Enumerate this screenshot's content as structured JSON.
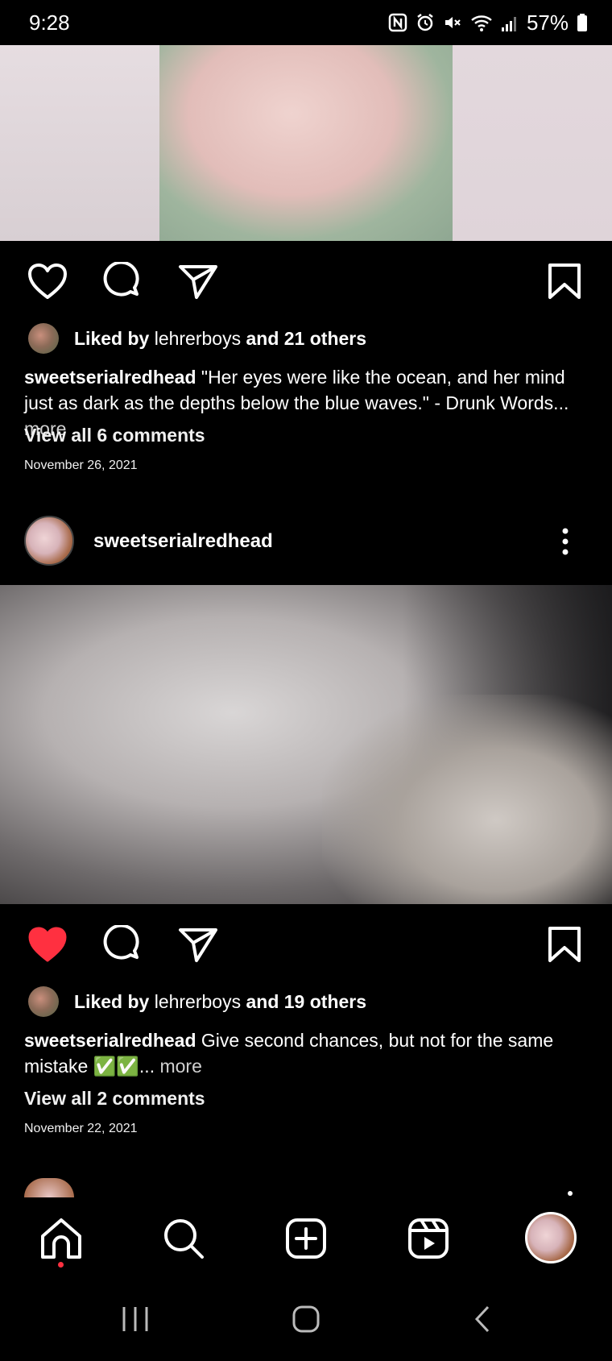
{
  "status_bar": {
    "time": "9:28",
    "battery": "57%",
    "icons": [
      "nfc-icon",
      "alarm-icon",
      "mute-icon",
      "wifi-icon",
      "signal-icon",
      "battery-icon"
    ]
  },
  "post1": {
    "liked_by_prefix": "Liked by",
    "liked_by_user": "lehrerboys",
    "liked_by_and": "and",
    "liked_by_others": "21 others",
    "caption_user": "sweetserialredhead",
    "caption_text": " \"Her eyes were like the ocean, and her mind just as dark as the depths below the blue waves.\" - Drunk Words...",
    "caption_more": " more",
    "view_comments": "View all 6 comments",
    "date": "November 26, 2021",
    "liked": false
  },
  "post2": {
    "username": "sweetserialredhead",
    "liked_by_prefix": "Liked by",
    "liked_by_user": "lehrerboys",
    "liked_by_and": "and",
    "liked_by_others": "19 others",
    "caption_user": "sweetserialredhead",
    "caption_text": " Give second chances, but not for the same mistake ✅✅...",
    "caption_more": " more",
    "view_comments": "View all 2 comments",
    "date": "November 22, 2021",
    "liked": true
  },
  "colors": {
    "background": "#000000",
    "like_red": "#ff3040",
    "text": "#ffffff"
  },
  "bottom_nav": [
    "home-icon",
    "search-icon",
    "create-icon",
    "reels-icon",
    "profile-avatar"
  ],
  "system_nav": [
    "recents-button",
    "home-button",
    "back-button"
  ]
}
